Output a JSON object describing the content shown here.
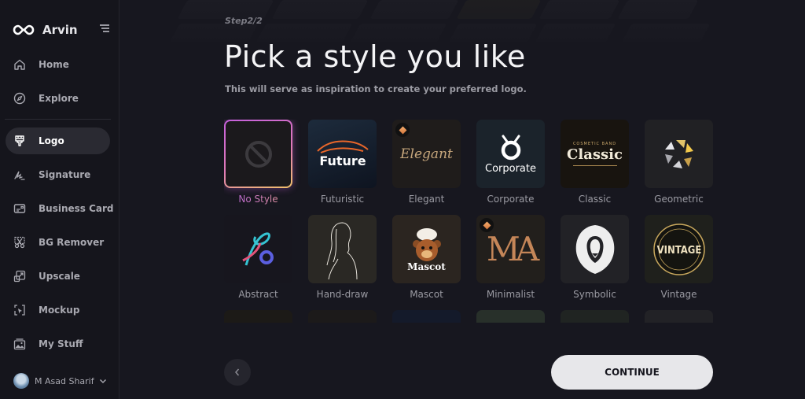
{
  "app": {
    "name": "Arvin"
  },
  "sidebar": {
    "items": [
      {
        "label": "Home",
        "icon": "home-icon",
        "active": false
      },
      {
        "label": "Explore",
        "icon": "compass-icon",
        "active": false
      },
      {
        "label": "Logo",
        "icon": "brush-icon",
        "active": true
      },
      {
        "label": "Signature",
        "icon": "signature-icon",
        "active": false
      },
      {
        "label": "Business Card",
        "icon": "id-card-icon",
        "active": false
      },
      {
        "label": "BG Remover",
        "icon": "scissors-icon",
        "active": false
      },
      {
        "label": "Upscale",
        "icon": "upscale-icon",
        "active": false
      },
      {
        "label": "Mockup",
        "icon": "mockup-icon",
        "active": false
      },
      {
        "label": "My Stuff",
        "icon": "gallery-icon",
        "active": false
      }
    ],
    "user": {
      "name": "M Asad Sharif"
    }
  },
  "main": {
    "step": "Step2/2",
    "title": "Pick a style you like",
    "subtitle": "This will serve as inspiration to create your preferred logo.",
    "styles": [
      {
        "label": "No Style",
        "selected": true,
        "premium": false,
        "thumb_text": ""
      },
      {
        "label": "Futuristic",
        "selected": false,
        "premium": false,
        "thumb_text": "Future"
      },
      {
        "label": "Elegant",
        "selected": false,
        "premium": true,
        "thumb_text": "Elegant"
      },
      {
        "label": "Corporate",
        "selected": false,
        "premium": false,
        "thumb_text": "Corporate"
      },
      {
        "label": "Classic",
        "selected": false,
        "premium": false,
        "thumb_text": "Classic",
        "thumb_subtext": "COSMETIC BAND"
      },
      {
        "label": "Geometric",
        "selected": false,
        "premium": false,
        "thumb_text": ""
      },
      {
        "label": "Abstract",
        "selected": false,
        "premium": false,
        "thumb_text": ""
      },
      {
        "label": "Hand-draw",
        "selected": false,
        "premium": false,
        "thumb_text": ""
      },
      {
        "label": "Mascot",
        "selected": false,
        "premium": false,
        "thumb_text": "Mascot"
      },
      {
        "label": "Minimalist",
        "selected": false,
        "premium": true,
        "thumb_text": "MA"
      },
      {
        "label": "Symbolic",
        "selected": false,
        "premium": false,
        "thumb_text": ""
      },
      {
        "label": "Vintage",
        "selected": false,
        "premium": false,
        "thumb_text": "VINTAGE"
      }
    ],
    "continue_label": "CONTINUE"
  },
  "colors": {
    "background": "#17171f",
    "sidebar": "#15151c",
    "selected_gradient_start": "#c45fdc",
    "selected_gradient_end": "#f1c26a",
    "button": "#e7e7ea"
  }
}
